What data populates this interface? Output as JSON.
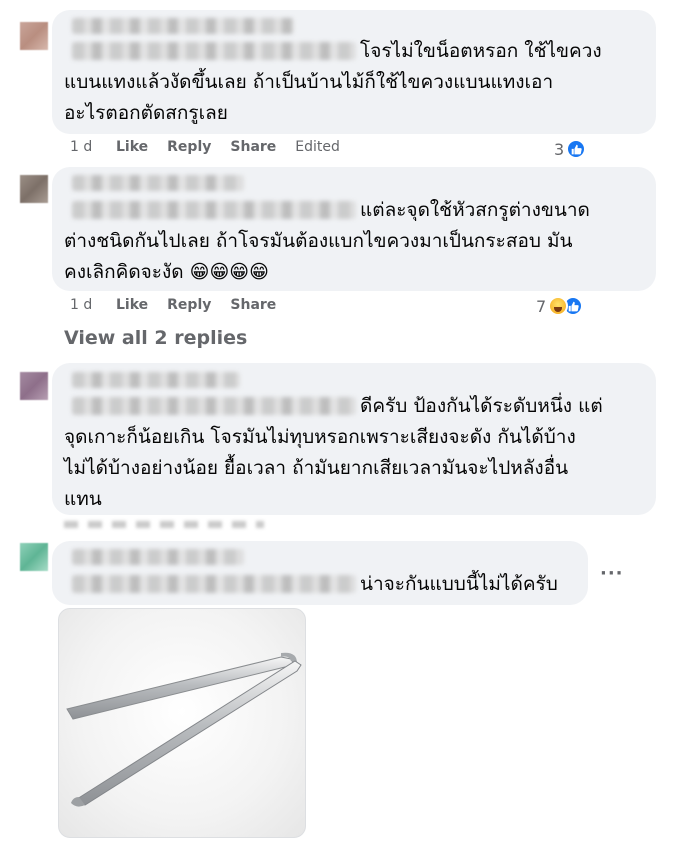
{
  "comments": [
    {
      "text": "โจรไม่ใขน็อตหรอก ใช้ไขควง\nแบนแทงแล้วงัดขึ้นเลย ถ้าเป็นบ้านไม้ก็ใช้ไขควงแบนแทงเอา\nอะไรตอกตัดสกรูเลย",
      "time": "1 d",
      "like_label": "Like",
      "reply_label": "Reply",
      "share_label": "Share",
      "edited_label": "Edited",
      "reaction_count": "3",
      "reaction_icons": [
        "like-icon"
      ]
    },
    {
      "text": "แต่ละจุดใช้หัวสกรูต่างขนาด\nต่างชนิดกันไปเลย ถ้าโจรมันต้องแบกไขควงมาเป็นกระสอบ มัน\nคงเลิกคิดจะงัด 😁😁😁😁",
      "time": "1 d",
      "like_label": "Like",
      "reply_label": "Reply",
      "share_label": "Share",
      "reaction_count": "7",
      "reaction_icons": [
        "haha-icon",
        "like-icon"
      ]
    },
    {
      "text": "ดีครับ ป้องกันได้ระดับหนึ่ง แต่\nจุดเกาะก็น้อยเกิน โจรมันไม่ทุบหรอกเพราะเสียงจะดัง กันได้บ้าง\nไม่ได้บ้างอย่างน้อย ยื้อเวลา ถ้ามันยากเสียเวลามันจะไปหลังอื่น\nแทน"
    },
    {
      "text": "น่าจะกันแบบนี้ไม่ได้ครับ",
      "more_label": "···"
    }
  ],
  "view_replies_label": "View all 2 replies",
  "colors": {
    "bubble": "#f0f2f5",
    "meta": "#65676b",
    "like_blue": "#1877f2"
  }
}
